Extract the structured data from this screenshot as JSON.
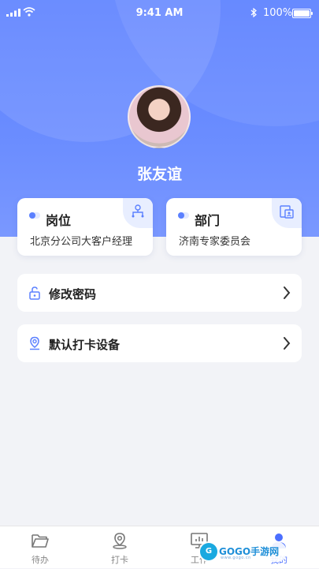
{
  "status_bar": {
    "time": "9:41 AM",
    "battery": "100%",
    "battery_level": 1.0
  },
  "profile": {
    "name": "张友谊"
  },
  "cards": [
    {
      "title": "岗位",
      "value": "北京分公司大客户经理",
      "icon": "org-icon"
    },
    {
      "title": "部门",
      "value": "济南专家委员会",
      "icon": "department-icon"
    }
  ],
  "menu": [
    {
      "label": "修改密码",
      "icon": "lock-icon"
    },
    {
      "label": "默认打卡设备",
      "icon": "location-pin-icon"
    }
  ],
  "tabs": [
    {
      "label": "待办",
      "icon": "folder-icon",
      "active": false
    },
    {
      "label": "打卡",
      "icon": "location-icon",
      "active": false
    },
    {
      "label": "工作",
      "icon": "monitor-chart-icon",
      "active": false
    },
    {
      "label": "我的",
      "icon": "user-icon",
      "active": true
    }
  ],
  "watermark": {
    "text": "GOGO手游网",
    "sub": "www.gogo.cn",
    "logo": "G"
  },
  "colors": {
    "primary": "#5b80ff",
    "tab_active": "#4b6fff",
    "background": "#f2f3f7"
  }
}
